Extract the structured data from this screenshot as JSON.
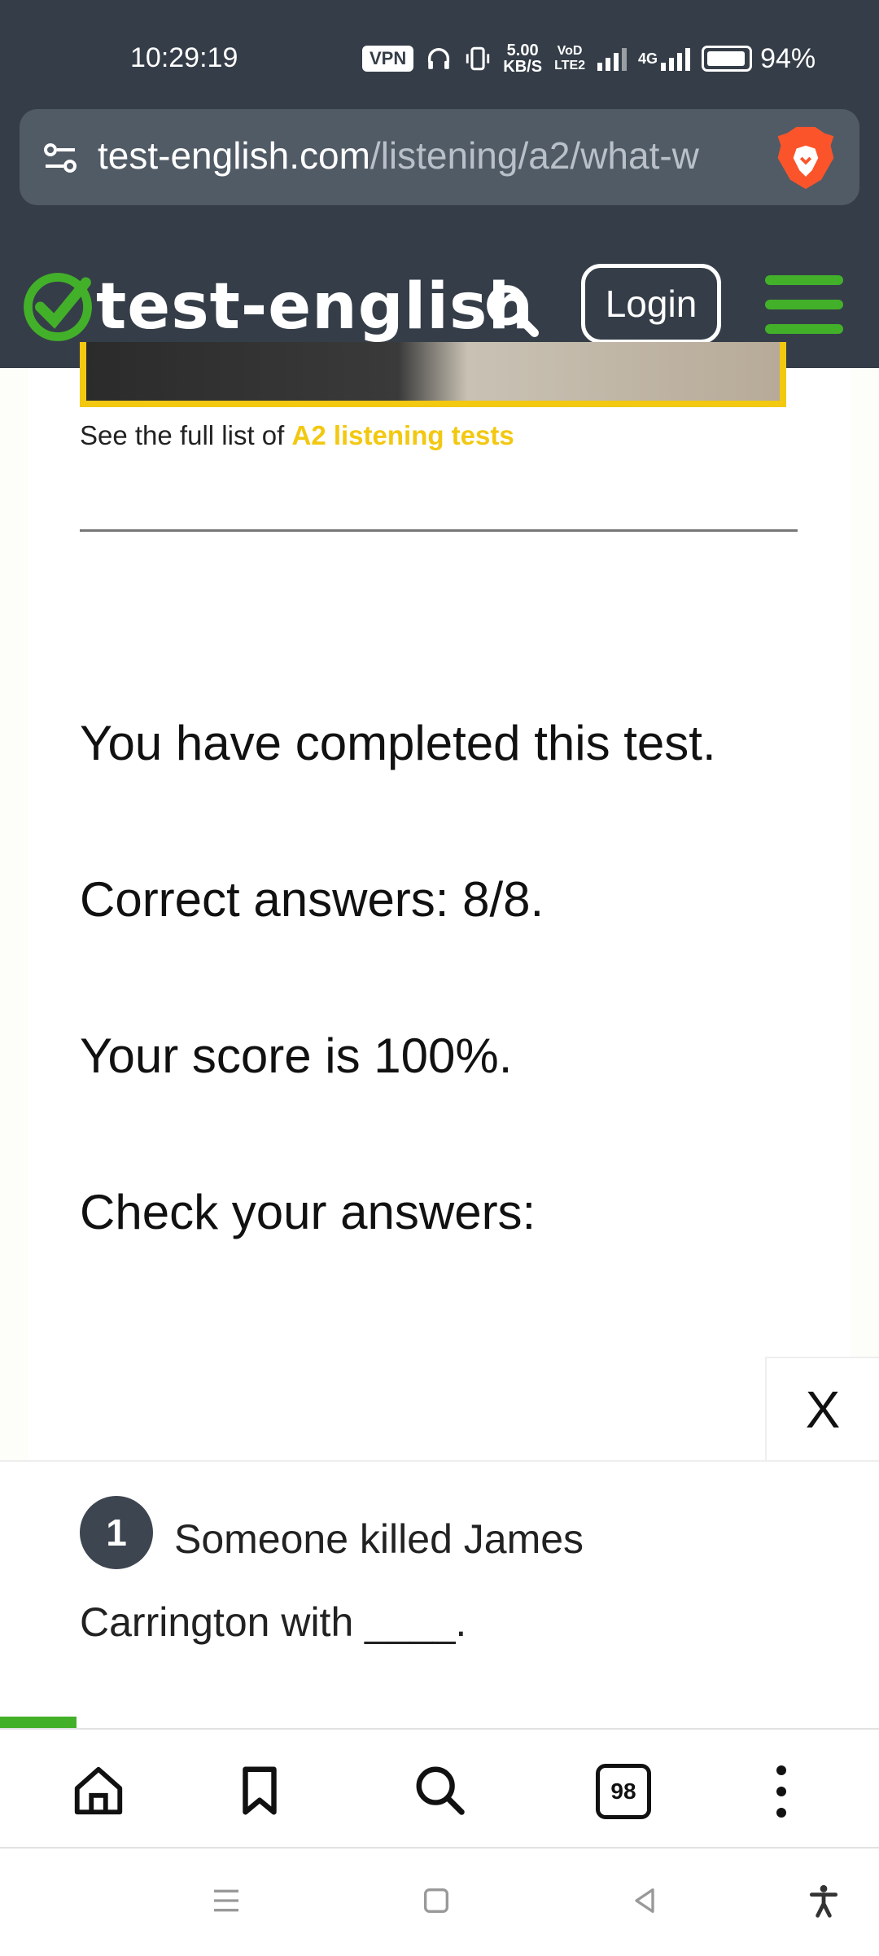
{
  "status_bar": {
    "time": "10:29:19",
    "vpn": "VPN",
    "net_speed_value": "5.00",
    "net_speed_unit": "KB/S",
    "volte": "VoD LTE2",
    "network": "4G",
    "battery": "94%"
  },
  "browser": {
    "url_domain": "test-english.com",
    "url_path": "/listening/a2/what-w"
  },
  "site": {
    "logo_text": "test-english",
    "login_label": "Login",
    "brand_green": "#43b02a",
    "accent_yellow": "#f2c811"
  },
  "content": {
    "full_list_prefix": "See the full list of ",
    "full_list_link": "A2 listening tests",
    "completed": "You have completed this test.",
    "correct_answers": "Correct answers: 8/8.",
    "score": "Your score is 100%.",
    "check_answers": "Check your answers:",
    "close_label": "X"
  },
  "question": {
    "number": "1",
    "line1": "Someone killed James",
    "line2": "Carrington with ____."
  },
  "bottom_bar": {
    "tabs_count": "98"
  }
}
